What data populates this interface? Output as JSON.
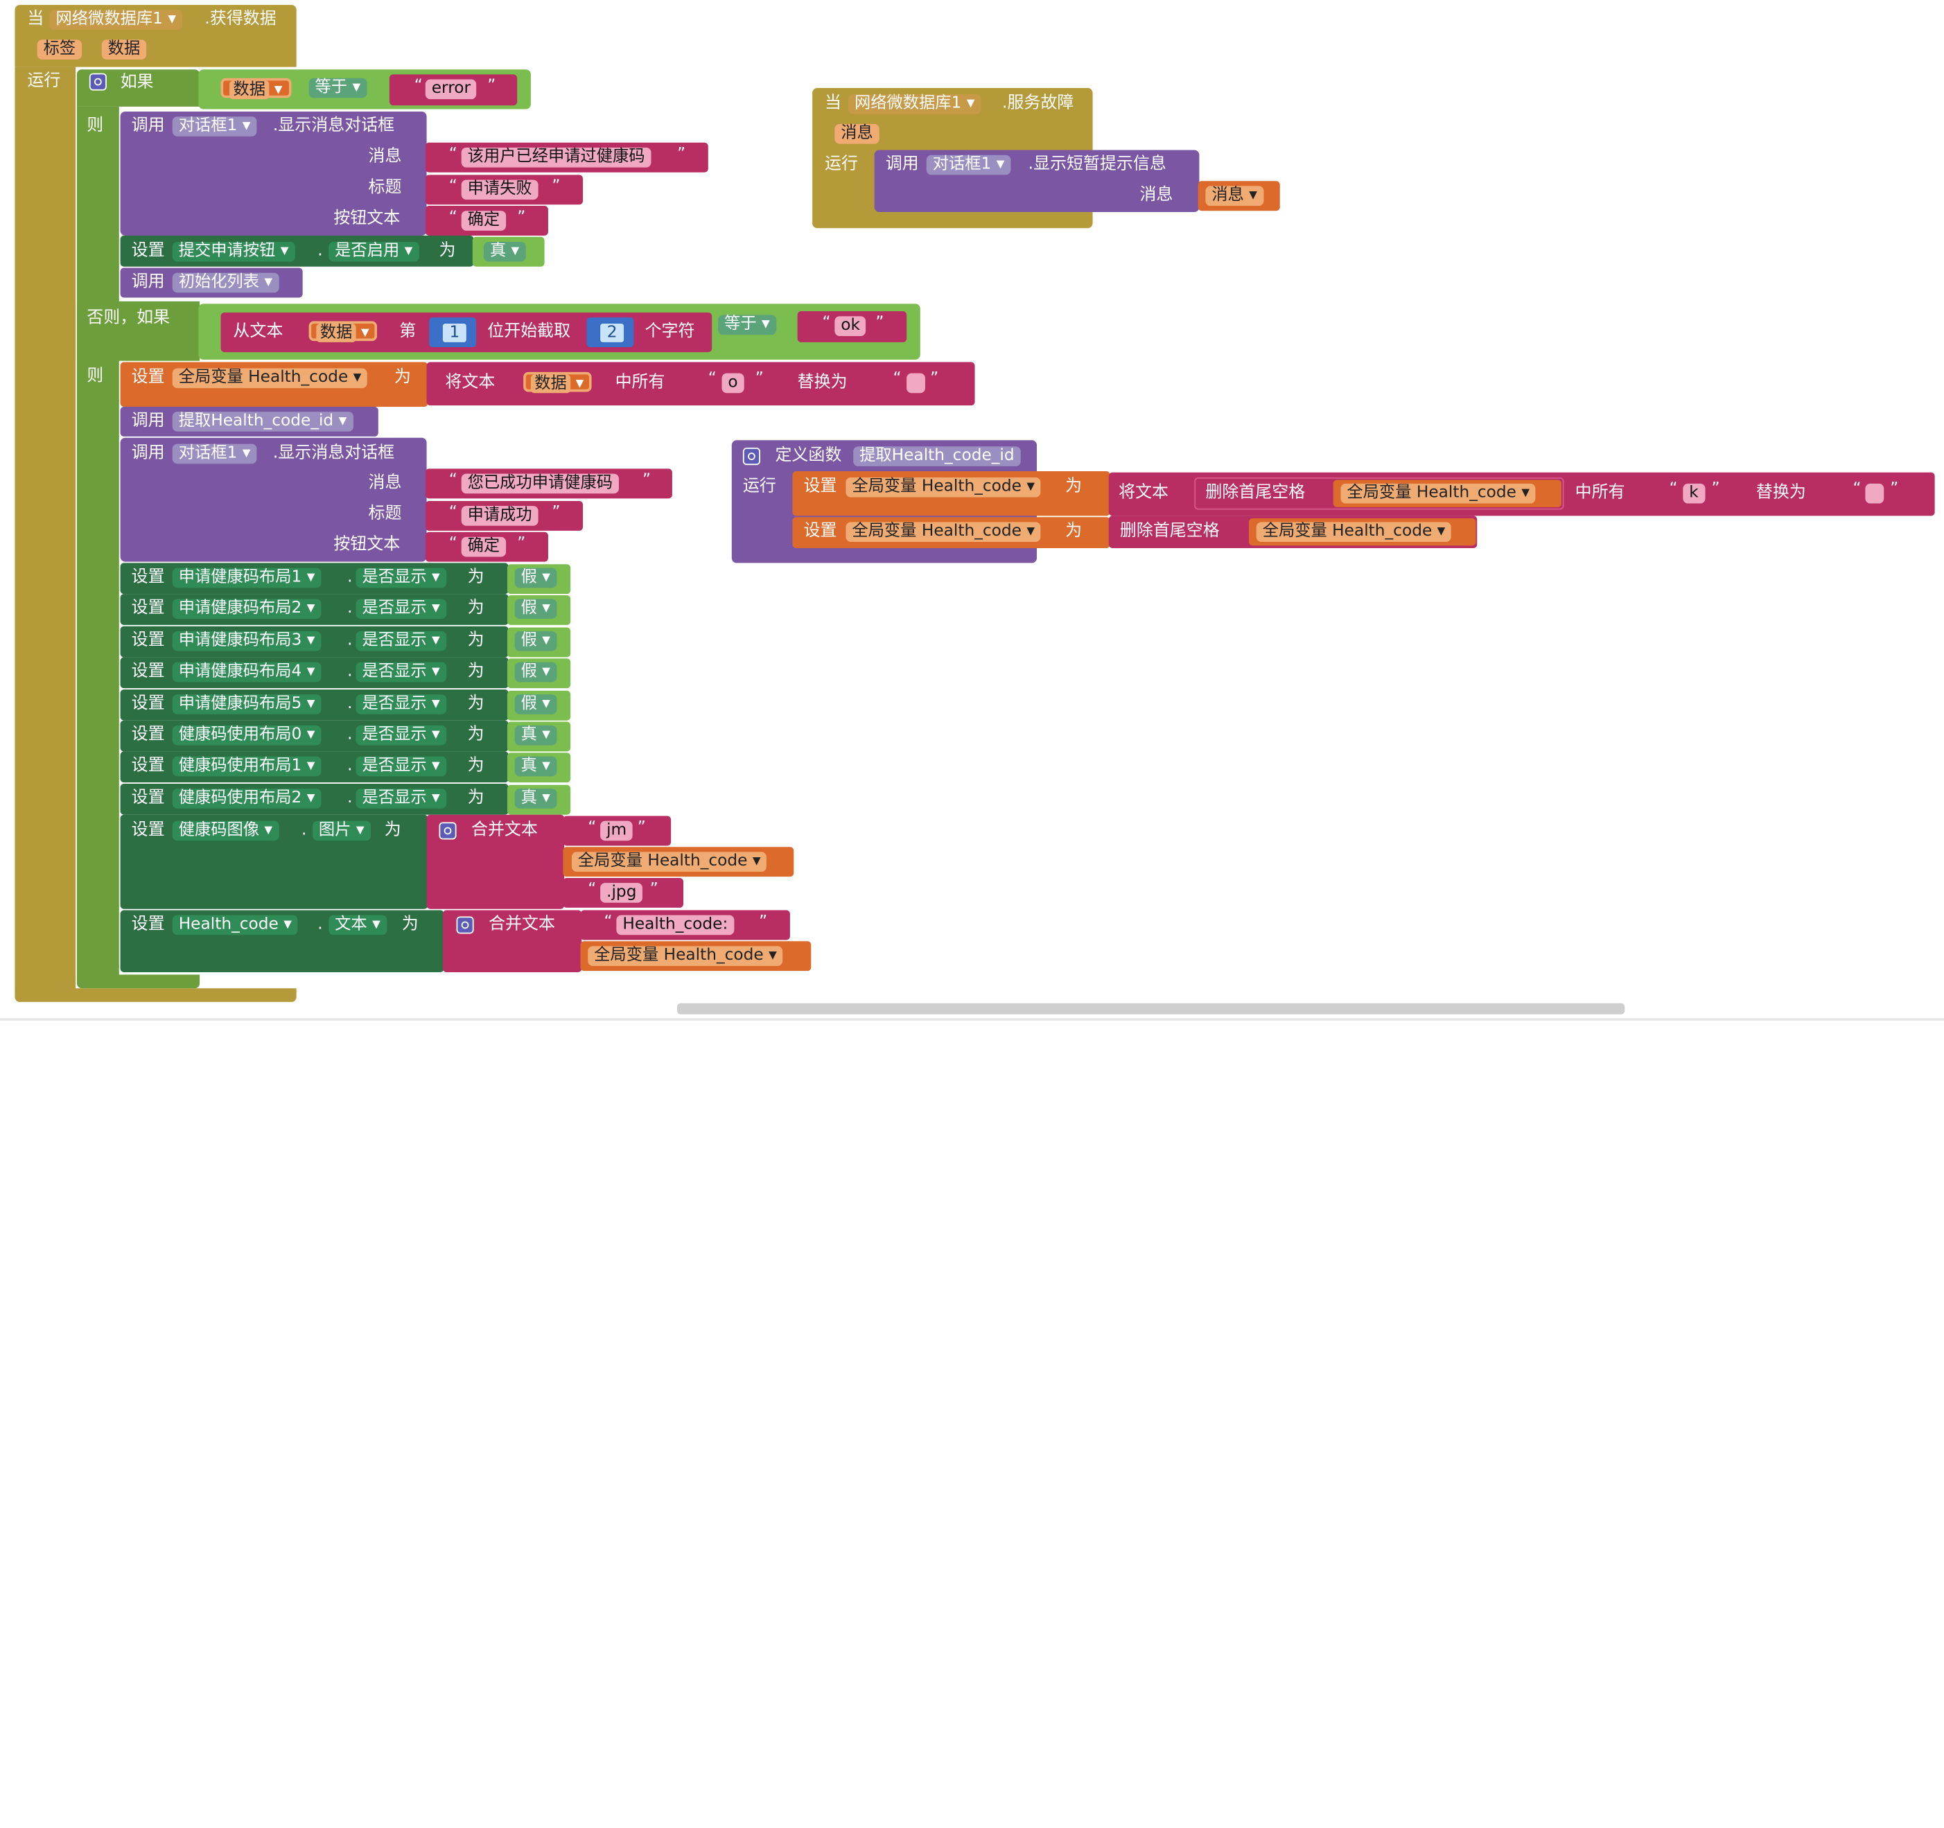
{
  "when1": {
    "kw": "当",
    "component": "网络微数据库1",
    "event": ".获得数据",
    "param1": "标签",
    "param2": "数据",
    "do": "运行"
  },
  "if1": {
    "label": "如果",
    "lhs": "数据",
    "op": "等于",
    "rhs": "error",
    "then": "则"
  },
  "dlg1": {
    "call": "调用",
    "component": "对话框1",
    "method": ".显示消息对话框",
    "msg_label": "消息",
    "msg": "该用户已经申请过健康码",
    "title_label": "标题",
    "title": "申请失败",
    "btn_label": "按钮文本",
    "btn": "确定"
  },
  "set_submit": {
    "set": "设置",
    "component": "提交申请按钮",
    "dot": ".",
    "prop": "是否启用",
    "to": "为",
    "value": "真"
  },
  "call_init": {
    "call": "调用",
    "proc": "初始化列表"
  },
  "elseif": {
    "label": "否则，如果",
    "from_text": "从文本",
    "var": "数据",
    "nth": "第",
    "start": "1",
    "start_suffix": "位开始截取",
    "len": "2",
    "len_suffix": "个字符",
    "op": "等于",
    "rhs": "ok",
    "then": "则"
  },
  "set_global1": {
    "set": "设置",
    "var": "全局变量 Health_code",
    "to": "为",
    "replace_kw": "将文本",
    "src": "数据",
    "in_all": "中所有",
    "find": "o",
    "replace_with": "替换为",
    "repl": ""
  },
  "call_extract": {
    "call": "调用",
    "proc": "提取Health_code_id"
  },
  "dlg2": {
    "call": "调用",
    "component": "对话框1",
    "method": ".显示消息对话框",
    "msg_label": "消息",
    "msg": "您已成功申请健康码",
    "title_label": "标题",
    "title": "申请成功",
    "btn_label": "按钮文本",
    "btn": "确定"
  },
  "visible_sets": [
    {
      "set": "设置",
      "component": "申请健康码布局1",
      "dot": ".",
      "prop": "是否显示",
      "to": "为",
      "value": "假"
    },
    {
      "set": "设置",
      "component": "申请健康码布局2",
      "dot": ".",
      "prop": "是否显示",
      "to": "为",
      "value": "假"
    },
    {
      "set": "设置",
      "component": "申请健康码布局3",
      "dot": ".",
      "prop": "是否显示",
      "to": "为",
      "value": "假"
    },
    {
      "set": "设置",
      "component": "申请健康码布局4",
      "dot": ".",
      "prop": "是否显示",
      "to": "为",
      "value": "假"
    },
    {
      "set": "设置",
      "component": "申请健康码布局5",
      "dot": ".",
      "prop": "是否显示",
      "to": "为",
      "value": "假"
    },
    {
      "set": "设置",
      "component": "健康码使用布局0",
      "dot": ".",
      "prop": "是否显示",
      "to": "为",
      "value": "真"
    },
    {
      "set": "设置",
      "component": "健康码使用布局1",
      "dot": ".",
      "prop": "是否显示",
      "to": "为",
      "value": "真"
    },
    {
      "set": "设置",
      "component": "健康码使用布局2",
      "dot": ".",
      "prop": "是否显示",
      "to": "为",
      "value": "真"
    }
  ],
  "set_image": {
    "set": "设置",
    "component": "健康码图像",
    "dot": ".",
    "prop": "图片",
    "to": "为",
    "join": "合并文本",
    "s1": "jm",
    "var": "全局变量 Health_code",
    "s2": ".jpg"
  },
  "set_label": {
    "set": "设置",
    "component": "Health_code",
    "dot": ".",
    "prop": "文本",
    "to": "为",
    "join": "合并文本",
    "s1": "Health_code:",
    "var": "全局变量 Health_code"
  },
  "when2": {
    "kw": "当",
    "component": "网络微数据库1",
    "event": ".服务故障",
    "param": "消息",
    "do": "运行",
    "call": "调用",
    "dlg": "对话框1",
    "method": ".显示短暂提示信息",
    "msg_label": "消息",
    "msg_value": "消息"
  },
  "proc": {
    "def": "定义函数",
    "name": "提取Health_code_id",
    "do": "运行",
    "r1_set": "设置",
    "r1_var": "全局变量 Health_code",
    "r1_to": "为",
    "r1_replace": "将文本",
    "r1_trim": "删除首尾空格",
    "r1_get": "全局变量 Health_code",
    "r1_in_all": "中所有",
    "r1_find": "k",
    "r1_repl_with": "替换为",
    "r1_repl": "",
    "r2_set": "设置",
    "r2_var": "全局变量 Health_code",
    "r2_to": "为",
    "r2_trim": "删除首尾空格",
    "r2_get": "全局变量 Health_code"
  },
  "colors": {
    "event": "#b59a3a",
    "control": "#6c9f3b",
    "component_purple": "#7b56a2",
    "component_green": "#2b6f43",
    "text": "#b82d62",
    "variable": "#db6a2b",
    "logic": "#7bbd4e",
    "math": "#3b6fc8"
  }
}
